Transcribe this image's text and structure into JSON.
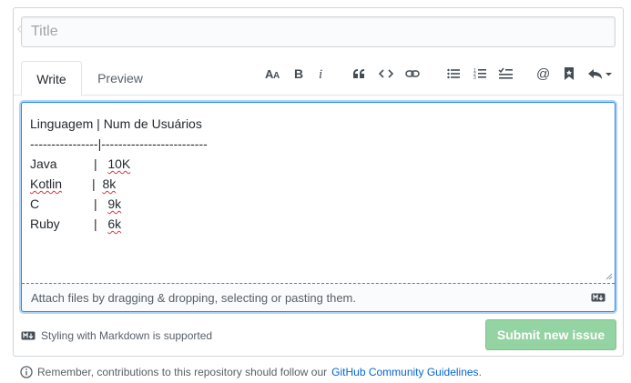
{
  "title_input": {
    "placeholder": "Title",
    "value": ""
  },
  "tabs": [
    {
      "label": "Write",
      "active": true
    },
    {
      "label": "Preview",
      "active": false
    }
  ],
  "toolbar_icons": [
    "text-size-icon",
    "bold-icon",
    "italic-icon",
    "quote-icon",
    "code-icon",
    "link-icon",
    "bulleted-list-icon",
    "numbered-list-icon",
    "task-list-icon",
    "mention-icon",
    "saved-reply-icon",
    "reply-icon"
  ],
  "editor": {
    "lines": [
      {
        "text": "Linguagem | Num de Usuários"
      },
      {
        "text": "----------------|-------------------------"
      },
      {
        "lang": "Java",
        "sep": "   |   ",
        "value": "10K"
      },
      {
        "lang": "Kotlin",
        "sep": "   |  ",
        "value": "8k"
      },
      {
        "lang": "C",
        "sep": "   |   ",
        "value": "9k"
      },
      {
        "lang": "Ruby",
        "sep": "   |   ",
        "value": "6k"
      }
    ],
    "attach_text": "Attach files by dragging & dropping, selecting or pasting them."
  },
  "markdown_note": "Styling with Markdown is supported",
  "submit_label": "Submit new issue",
  "footer": {
    "text": "Remember, contributions to this repository should follow our",
    "link": "GitHub Community Guidelines",
    "suffix": "."
  },
  "colors": {
    "accent": "#2188ff",
    "submit_disabled": "#94d3a2",
    "link": "#0366d6"
  }
}
